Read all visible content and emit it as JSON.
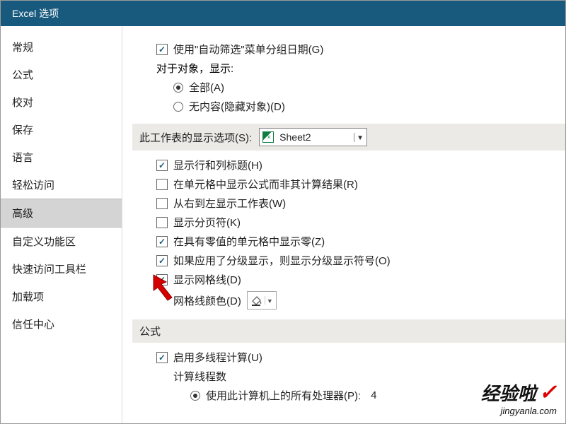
{
  "title": "Excel 选项",
  "sidebar": {
    "items": [
      {
        "label": "常规"
      },
      {
        "label": "公式"
      },
      {
        "label": "校对"
      },
      {
        "label": "保存"
      },
      {
        "label": "语言"
      },
      {
        "label": "轻松访问"
      },
      {
        "label": "高级"
      },
      {
        "label": "自定义功能区"
      },
      {
        "label": "快速访问工具栏"
      },
      {
        "label": "加载项"
      },
      {
        "label": "信任中心"
      }
    ]
  },
  "opt": {
    "autofilter_group_dates": "使用\"自动筛选\"菜单分组日期(G)",
    "for_objects_label": "对于对象，显示:",
    "obj_all": "全部(A)",
    "obj_none": "无内容(隐藏对象)(D)",
    "worksheet_section": "此工作表的显示选项(S):",
    "sheet_name": "Sheet2",
    "show_row_col_headers": "显示行和列标题(H)",
    "show_formulas": "在单元格中显示公式而非其计算结果(R)",
    "rtl_sheet": "从右到左显示工作表(W)",
    "show_page_breaks": "显示分页符(K)",
    "show_zero": "在具有零值的单元格中显示零(Z)",
    "show_outline": "如果应用了分级显示，则显示分级显示符号(O)",
    "show_gridlines": "显示网格线(D)",
    "gridline_color": "网格线颜色(D)",
    "formulas_section": "公式",
    "multithread": "启用多线程计算(U)",
    "thread_count_label": "计算线程数",
    "use_all_cpus": "使用此计算机上的所有处理器(P):",
    "cpu_count": "4"
  },
  "watermark": {
    "main": "经验啦",
    "sub": "jingyanla.com"
  }
}
